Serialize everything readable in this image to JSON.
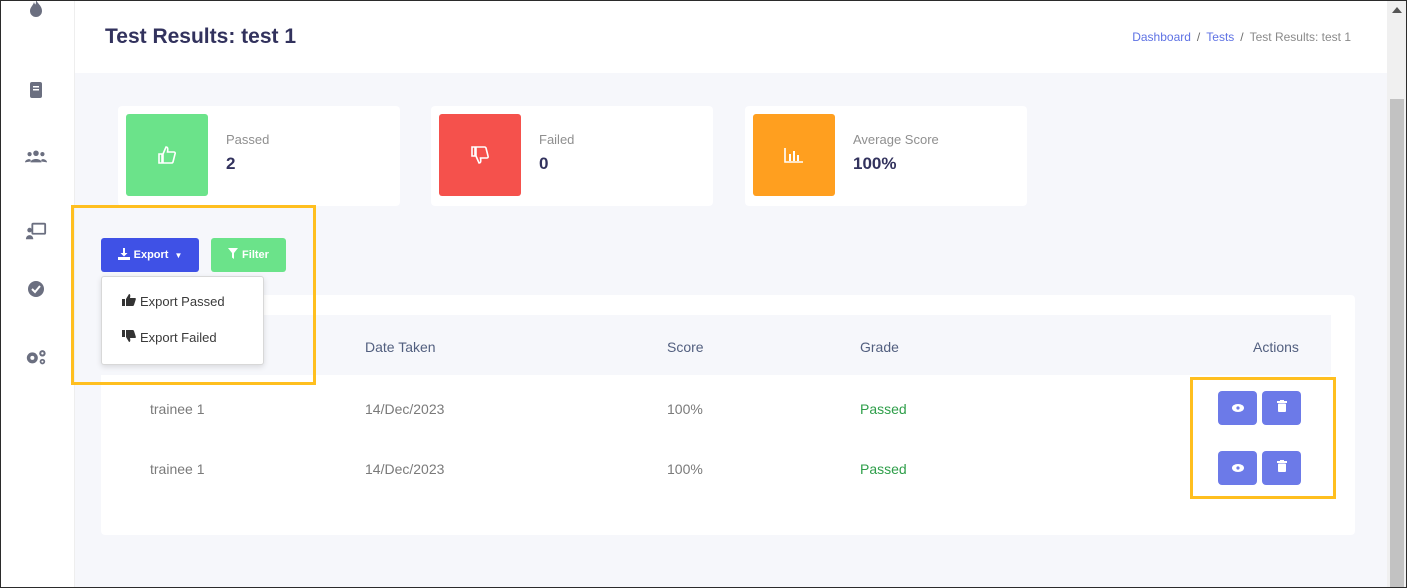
{
  "header": {
    "title": "Test Results: test 1",
    "breadcrumb": {
      "dashboard": "Dashboard",
      "tests": "Tests",
      "current": "Test Results: test 1",
      "separator": "/"
    }
  },
  "sidebar": {
    "icons": [
      "flame-icon",
      "book-icon",
      "users-icon",
      "presentation-icon",
      "check-circle-icon",
      "cogs-icon"
    ]
  },
  "stats": {
    "passed": {
      "label": "Passed",
      "value": "2",
      "color": "#6be38a",
      "icon": "thumbs-up-icon"
    },
    "failed": {
      "label": "Failed",
      "value": "0",
      "color": "#f5514c",
      "icon": "thumbs-down-icon"
    },
    "average": {
      "label": "Average Score",
      "value": "100%",
      "color": "#ff9f1f",
      "icon": "bar-chart-icon"
    }
  },
  "toolbar": {
    "export_label": "Export",
    "filter_label": "Filter",
    "export_menu": {
      "passed": "Export Passed",
      "failed": "Export Failed"
    }
  },
  "table": {
    "headers": {
      "date": "Date Taken",
      "score": "Score",
      "grade": "Grade",
      "actions": "Actions"
    },
    "rows": [
      {
        "name": "trainee 1",
        "date": "14/Dec/2023",
        "score": "100%",
        "grade": "Passed"
      },
      {
        "name": "trainee 1",
        "date": "14/Dec/2023",
        "score": "100%",
        "grade": "Passed"
      }
    ]
  },
  "colors": {
    "primary": "#3f51e6",
    "success": "#6be38a",
    "danger": "#f5514c",
    "warning": "#ff9f1f",
    "highlight": "#ffbf1f"
  }
}
